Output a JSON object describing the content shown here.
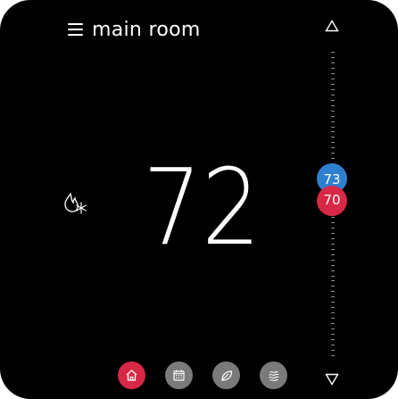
{
  "header": {
    "menu_icon": "hamburger-menu-icon",
    "title": "main room"
  },
  "thermostat": {
    "current_temp": "72",
    "mode_icon": "flame-snowflake-icon",
    "cool_setpoint": "73",
    "heat_setpoint": "70"
  },
  "scale": {
    "up_icon": "triangle-up-icon",
    "down_icon": "triangle-down-icon"
  },
  "nav": {
    "items": [
      {
        "icon": "home-icon",
        "active": true
      },
      {
        "icon": "calendar-icon",
        "active": false
      },
      {
        "icon": "leaf-icon",
        "active": false
      },
      {
        "icon": "waves-icon",
        "active": false
      }
    ]
  },
  "colors": {
    "background": "#000000",
    "cool": "#2f7fd0",
    "heat": "#d72845",
    "nav_inactive": "#7a7a7a",
    "nav_active": "#d72845"
  }
}
